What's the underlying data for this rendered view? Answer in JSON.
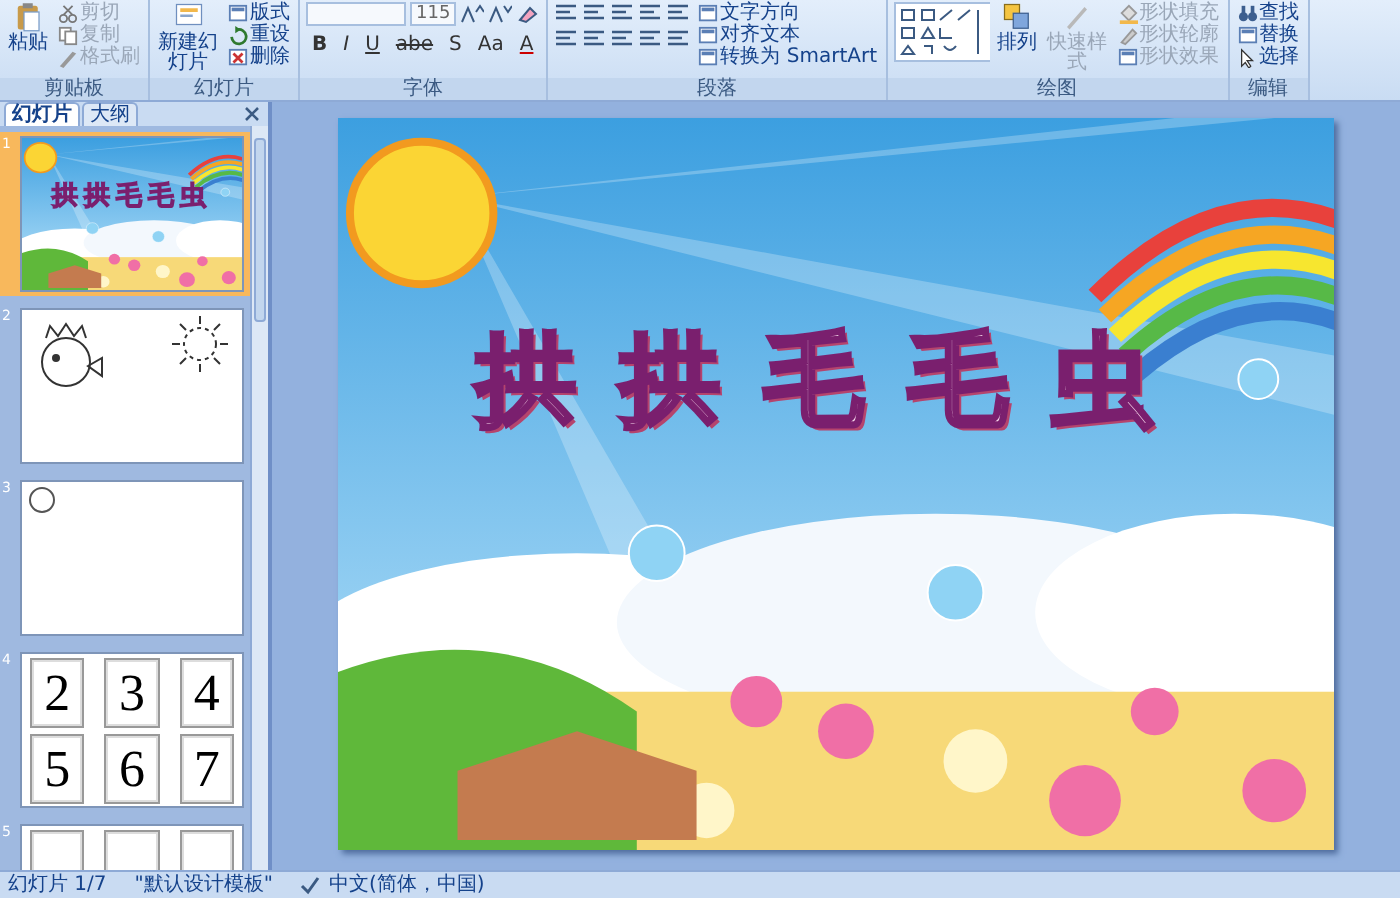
{
  "ribbon": {
    "groups": [
      {
        "kind": "buttons",
        "label": "剪贴板",
        "large": [
          {
            "label": "粘贴",
            "disabled": false
          }
        ],
        "small": [
          {
            "label": "剪切",
            "disabled": true
          },
          {
            "label": "复制",
            "disabled": true
          },
          {
            "label": "格式刷",
            "disabled": true
          }
        ]
      },
      {
        "kind": "buttons",
        "label": "幻灯片",
        "large": [
          {
            "label": "新建幻灯片",
            "disabled": false
          }
        ],
        "small": [
          {
            "label": "版式",
            "disabled": false
          },
          {
            "label": "重设",
            "disabled": false
          },
          {
            "label": "删除",
            "disabled": false
          }
        ]
      },
      {
        "kind": "font",
        "label": "字体",
        "font_size": "115",
        "buttons": [
          "B",
          "I",
          "U",
          "abe",
          "S",
          "Aa",
          "A"
        ]
      },
      {
        "kind": "paragraph",
        "label": "段落",
        "small": [
          {
            "label": "文字方向",
            "disabled": false
          },
          {
            "label": "对齐文本",
            "disabled": false
          },
          {
            "label": "转换为 SmartArt",
            "disabled": false
          }
        ]
      },
      {
        "kind": "drawing",
        "label": "绘图",
        "large": [
          {
            "label": "排列",
            "disabled": false
          },
          {
            "label": "快速样式",
            "disabled": true
          }
        ],
        "small": [
          {
            "label": "形状填充",
            "disabled": true
          },
          {
            "label": "形状轮廓",
            "disabled": true
          },
          {
            "label": "形状效果",
            "disabled": true
          }
        ]
      },
      {
        "kind": "buttons",
        "label": "编辑",
        "small": [
          {
            "label": "查找",
            "disabled": false
          },
          {
            "label": "替换",
            "disabled": false
          },
          {
            "label": "选择",
            "disabled": false
          }
        ]
      }
    ]
  },
  "panel": {
    "tabs": [
      {
        "label": "幻灯片",
        "selected": true
      },
      {
        "label": "大纲",
        "selected": false
      }
    ],
    "slides": [
      {
        "number": "1",
        "selected": true,
        "kind": "title",
        "title": "拱拱毛毛虫"
      },
      {
        "number": "2",
        "selected": false,
        "kind": "drawing"
      },
      {
        "number": "3",
        "selected": false,
        "kind": "circle"
      },
      {
        "number": "4",
        "selected": false,
        "kind": "cards",
        "cards": [
          "2",
          "3",
          "4",
          "5",
          "6",
          "7"
        ]
      },
      {
        "number": "5",
        "selected": false,
        "kind": "partial"
      }
    ]
  },
  "slide": {
    "title": "拱拱毛毛虫"
  },
  "status_bar": {
    "slide": "幻灯片 1/7",
    "theme": "\"默认设计模板\"",
    "language": "中文(简体，中国)"
  }
}
